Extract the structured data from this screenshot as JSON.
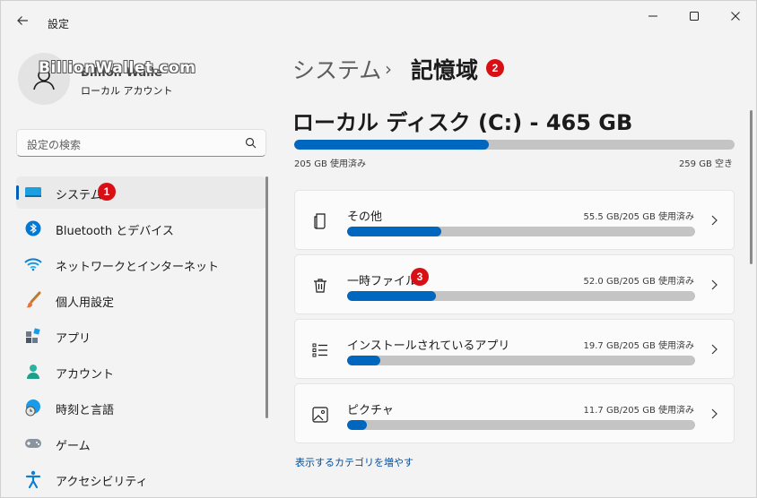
{
  "window": {
    "title": "設定",
    "back_icon": "back-arrow-icon"
  },
  "profile": {
    "name": "Billion Walle",
    "account_type": "ローカル アカウント",
    "watermark": "BillionWallet.com"
  },
  "search": {
    "placeholder": "設定の検索"
  },
  "nav": {
    "items": [
      {
        "label": "システム",
        "icon": "system-icon",
        "active": true
      },
      {
        "label": "Bluetooth とデバイス",
        "icon": "bluetooth-icon"
      },
      {
        "label": "ネットワークとインターネット",
        "icon": "wifi-icon"
      },
      {
        "label": "個人用設定",
        "icon": "brush-icon"
      },
      {
        "label": "アプリ",
        "icon": "apps-icon"
      },
      {
        "label": "アカウント",
        "icon": "account-icon"
      },
      {
        "label": "時刻と言語",
        "icon": "globe-clock-icon"
      },
      {
        "label": "ゲーム",
        "icon": "gamepad-icon"
      },
      {
        "label": "アクセシビリティ",
        "icon": "accessibility-icon"
      }
    ]
  },
  "breadcrumb": {
    "parent": "システム",
    "separator": "›",
    "current": "記憶域"
  },
  "badges": {
    "one": "1",
    "two": "2",
    "three": "3"
  },
  "disk": {
    "title": "ローカル ディスク (C:) - 465 GB",
    "used_label": "205 GB 使用済み",
    "free_label": "259 GB 空き",
    "used_fraction": 0.441
  },
  "categories": [
    {
      "label": "その他",
      "size": "55.5 GB/205 GB 使用済み",
      "fraction": 0.271,
      "icon": "document-icon"
    },
    {
      "label": "一時ファイル",
      "size": "52.0 GB/205 GB 使用済み",
      "fraction": 0.254,
      "icon": "trash-icon"
    },
    {
      "label": "インストールされているアプリ",
      "size": "19.7 GB/205 GB 使用済み",
      "fraction": 0.096,
      "icon": "list-icon"
    },
    {
      "label": "ピクチャ",
      "size": "11.7 GB/205 GB 使用済み",
      "fraction": 0.057,
      "icon": "picture-icon"
    }
  ],
  "more_link": "表示するカテゴリを増やす",
  "colors": {
    "accent": "#0067c0",
    "badge": "#d90f16",
    "track": "#c4c4c4"
  }
}
